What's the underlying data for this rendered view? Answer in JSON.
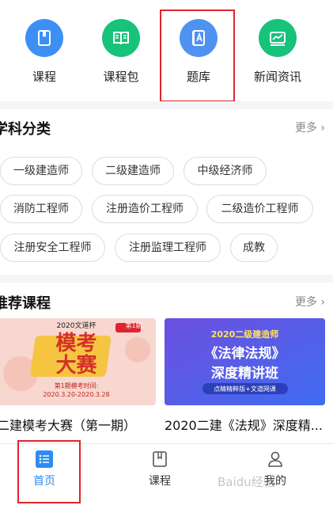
{
  "quick_nav": [
    {
      "label": "课程",
      "icon": "bookmark-book-icon",
      "color": "#3d8ff5"
    },
    {
      "label": "课程包",
      "icon": "open-book-icon",
      "color": "#17c27a"
    },
    {
      "label": "题库",
      "icon": "question-bank-icon",
      "color": "#4e92f2"
    },
    {
      "label": "新闻资讯",
      "icon": "news-chart-icon",
      "color": "#17c27a"
    }
  ],
  "subjects": {
    "title": "学科分类",
    "more": "更多",
    "chips": [
      "一级建造师",
      "二级建造师",
      "中级经济师",
      "消防工程师",
      "注册造价工程师",
      "二级造价工程师",
      "注册安全工程师",
      "注册监理工程师",
      "成教"
    ]
  },
  "recommend": {
    "title": "推荐课程",
    "more": "更多",
    "cards": [
      {
        "title": "二建模考大赛（第一期）",
        "banner_top": "2020文道杯",
        "banner_big1": "模考",
        "banner_big2": "大赛",
        "banner_sub1": "第1期模考时间:",
        "banner_sub2": "2020.3.20-2020.3.28",
        "banner_tag": "第1期"
      },
      {
        "title": "2020二建《法规》深度精...",
        "banner_top": "2020二级建造师",
        "banner_big1": "《法律法规》",
        "banner_big2": "深度精讲班",
        "banner_sub1": "点睛精粹版+文道网课"
      }
    ]
  },
  "tabbar": {
    "items": [
      {
        "label": "首页",
        "icon": "home-list-icon"
      },
      {
        "label": "课程",
        "icon": "course-book-icon"
      },
      {
        "label": "我的",
        "icon": "user-icon"
      }
    ],
    "watermark": "Baidu经验"
  },
  "colors": {
    "highlight": "#e0242e",
    "active_tab": "#2d8cf0"
  }
}
